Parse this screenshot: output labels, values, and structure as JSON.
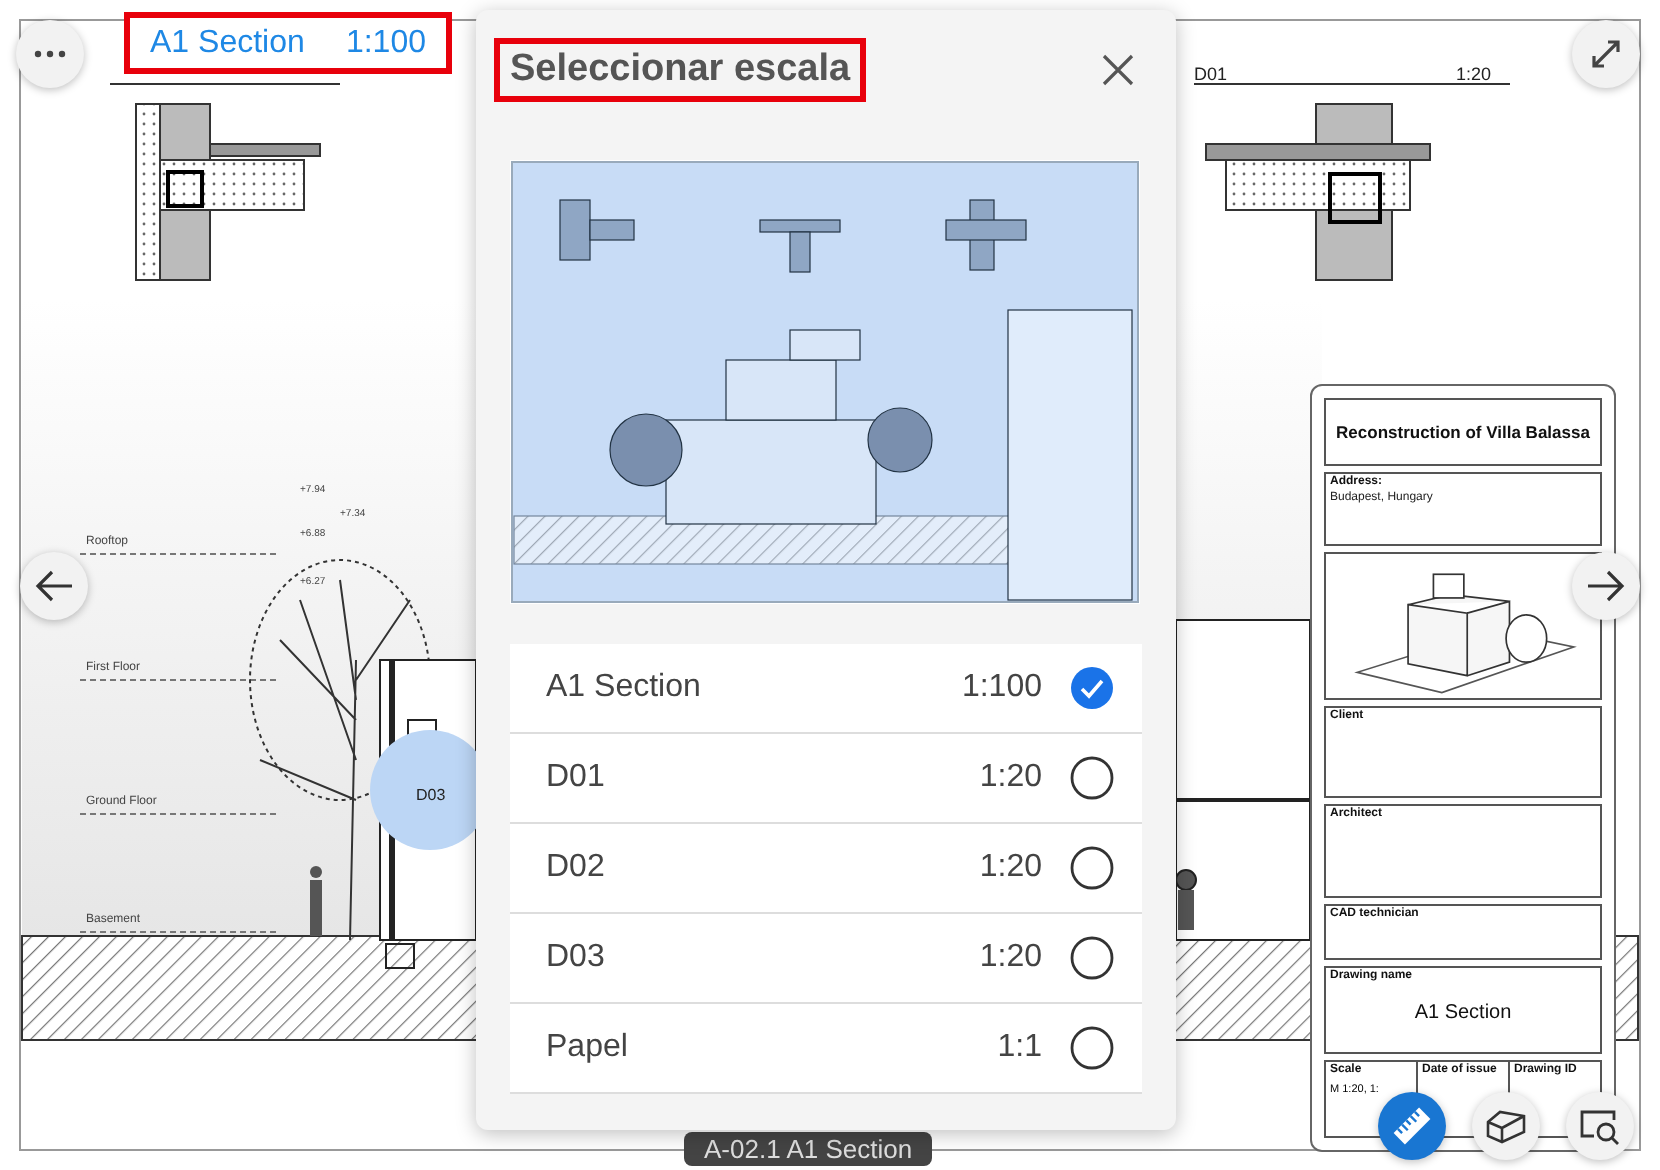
{
  "toolbar": {
    "view_name": "A1 Section",
    "view_scale": "1:100"
  },
  "drawing": {
    "details": [
      {
        "name": "D01",
        "scale": "1:20"
      }
    ],
    "levels": [
      "Rooftop",
      "First Floor",
      "Ground Floor",
      "Basement"
    ],
    "elevations": [
      "+7.94",
      "+7.34",
      "+6.88",
      "+6.27"
    ],
    "marker": "D03",
    "title_block": {
      "title": "Reconstruction of Villa Balassa",
      "address_label": "Address:",
      "address": "Budapest, Hungary",
      "client_label": "Client",
      "architect_label": "Architect",
      "cad_label": "CAD technician",
      "drawing_name_label": "Drawing name",
      "drawing_name": "A1 Section",
      "scale_label": "Scale",
      "date_label": "Date of issue",
      "id_label": "Drawing ID",
      "scale_value": "M 1:20, 1:"
    }
  },
  "sheet_label": "A-02.1 A1 Section",
  "dialog": {
    "title": "Seleccionar escala",
    "options": [
      {
        "name": "A1 Section",
        "scale": "1:100",
        "selected": true
      },
      {
        "name": "D01",
        "scale": "1:20",
        "selected": false
      },
      {
        "name": "D02",
        "scale": "1:20",
        "selected": false
      },
      {
        "name": "D03",
        "scale": "1:20",
        "selected": false
      },
      {
        "name": "Papel",
        "scale": "1:1",
        "selected": false
      }
    ]
  }
}
